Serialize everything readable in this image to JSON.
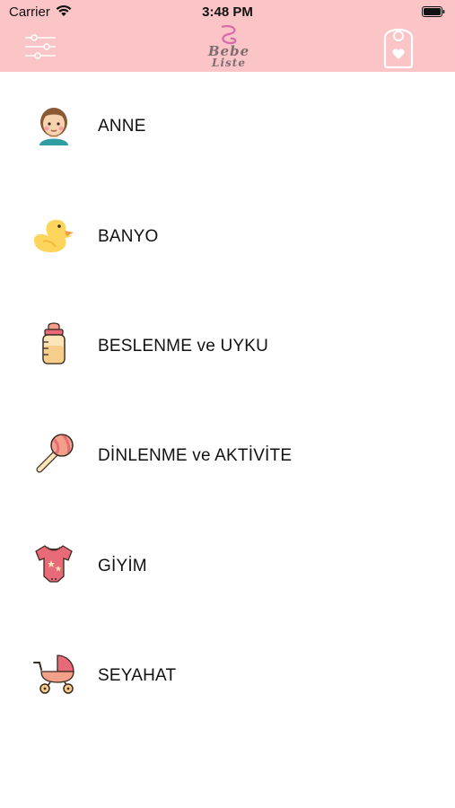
{
  "status_bar": {
    "carrier": "Carrier",
    "time": "3:48 PM"
  },
  "nav": {
    "logo_line1": "Bebe",
    "logo_line2": "Liste",
    "filter_icon": "sliders-icon",
    "tag_icon": "door-hanger-heart-icon"
  },
  "colors": {
    "header_bg": "#fbc4c6",
    "text": "#111111",
    "icon_pink": "#e86a78"
  },
  "categories": [
    {
      "label": "ANNE",
      "icon": "mother-icon"
    },
    {
      "label": "BANYO",
      "icon": "rubber-duck-icon"
    },
    {
      "label": "BESLENME ve UYKU",
      "icon": "baby-bottle-icon"
    },
    {
      "label": "DİNLENME ve AKTİVİTE",
      "icon": "rattle-icon"
    },
    {
      "label": "GİYİM",
      "icon": "onesie-icon"
    },
    {
      "label": "SEYAHAT",
      "icon": "stroller-icon"
    }
  ]
}
